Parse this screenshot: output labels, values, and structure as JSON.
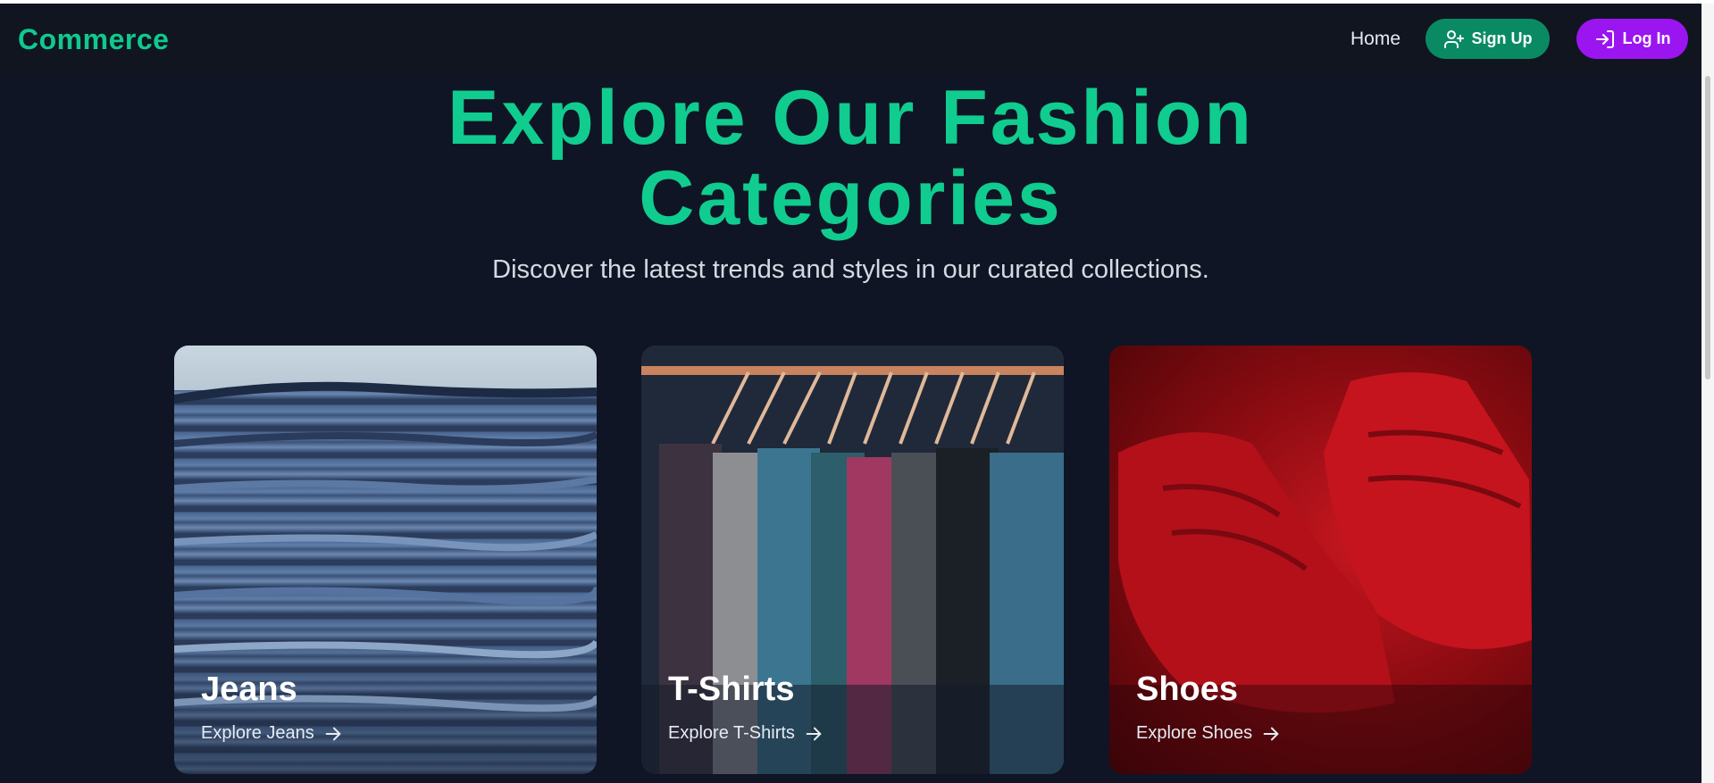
{
  "nav": {
    "brand": "Commerce",
    "home": "Home",
    "signup": "Sign Up",
    "login": "Log In"
  },
  "hero": {
    "title_line1": "Explore Our Fashion",
    "title_line2": "Categories",
    "subtitle": "Discover the latest trends and styles in our curated collections."
  },
  "categories": [
    {
      "name": "Jeans",
      "link": "Explore Jeans"
    },
    {
      "name": "T-Shirts",
      "link": "Explore T-Shirts"
    },
    {
      "name": "Shoes",
      "link": "Explore Shoes"
    }
  ],
  "colors": {
    "accent": "#10cc8f",
    "signup": "#0a8a63",
    "login": "#9b15f0",
    "background": "#0f1524"
  }
}
